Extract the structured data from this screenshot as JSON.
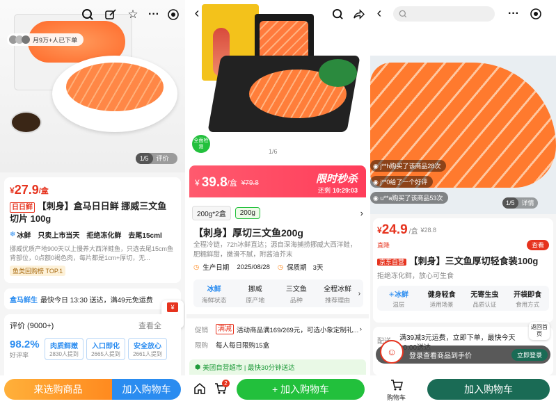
{
  "p1": {
    "join_text": "月9万+人已下单",
    "pager": "1/5",
    "review_tab": "评价",
    "price_symbol": "¥",
    "price_int": "27.9",
    "price_unit": "/盒",
    "brand_tag": "日日鲜",
    "title": "【刺身】盒马日日鲜 挪威三文鱼切片 100g",
    "features": [
      "冰鲜",
      "只卖上市当天",
      "拒绝冻化鲜",
      "去尾15cml"
    ],
    "desc": "挪威优质产地900天以上慢养大西洋鲑鱼，只选去尾15cm鱼背部位，0点额0褐色肉，每片都是1cm+厚切，无...",
    "rank": "鱼类回购榜 TOP.1",
    "delivery_brand": "盒马鲜生",
    "delivery_text": "最快今日 13:30 送达，满49元免运费",
    "card_coupon": "卡券",
    "review_title": "评价 (9000+)",
    "review_more": "查看全",
    "rate": "98.2%",
    "rate_label": "好评率",
    "review_tags": [
      {
        "title": "肉质鲜嫩",
        "sub": "2830人提到"
      },
      {
        "title": "入口即化",
        "sub": "2665人提到"
      },
      {
        "title": "安全放心",
        "sub": "2661人提到"
      }
    ],
    "btn_left": "来选购商品",
    "btn_right": "加入购物车"
  },
  "p2": {
    "pager": "1/6",
    "badge": "全面检测",
    "price_symbol": "¥",
    "price": "39.8",
    "price_unit": "/盒",
    "price_old": "¥79.8",
    "flash_title": "限时秒杀",
    "countdown_prefix": "还剩",
    "countdown": "10:29:03",
    "spec_options": [
      "200g*2盒",
      "200g"
    ],
    "title": "【刺身】厚切三文鱼200g",
    "desc": "全程冷链，72h冰鲜直达；源自深海捕捞挪威大西洋鲑，肥糯鲜甜，嫩滑不腻，附酱油芥末",
    "prod_label": "生产日期",
    "prod_date": "2025/08/28",
    "shelf_label": "保质期",
    "shelf_value": "3天",
    "attrs": [
      {
        "value": "冰鲜",
        "key": "海鲜状态"
      },
      {
        "value": "挪威",
        "key": "原产地"
      },
      {
        "value": "三文鱼",
        "key": "品种"
      },
      {
        "value": "全程冰鲜",
        "key": "推荐理由"
      }
    ],
    "promo_label": "促销",
    "promo_tag": "满减",
    "promo_text": "活动商品满169/269元，可选小象定制礼...",
    "limit_label": "限购",
    "limit_text": "每人每日限购15盒",
    "store_text": "美团自营超市 | 最快30分钟送达",
    "cart_count": "2",
    "btn_cart": "+ 加入购物车"
  },
  "p3": {
    "barrage": [
      "j**h购买了该商品28次",
      "j**0给了一个好评",
      "u**a购买了该商品53次"
    ],
    "pager": "1/5",
    "detail_tab": "详情",
    "price_symbol": "¥",
    "price": "24.9",
    "price_unit": "/盒",
    "price_old": "¥28.8",
    "direct_tag": "直降",
    "view_btn": "查看",
    "jd_tag": "京东自营",
    "title": "【刺身】三文鱼厚切轻食装100g",
    "desc": "拒绝冻化鲜，放心可生食",
    "attrs": [
      {
        "value": "冰鲜",
        "key": "温层"
      },
      {
        "value": "健身轻食",
        "key": "适用场景"
      },
      {
        "value": "无寄生虫",
        "key": "品质认证"
      },
      {
        "value": "开袋即食",
        "key": "食用方式"
      }
    ],
    "delivery_label": "配送",
    "delivery_text": "满39减3元运费，立即下单，最快今天10:00送达",
    "back_home": "返回首页",
    "login_text": "登录查看商品到手价",
    "login_btn": "立即登录",
    "cart_label": "购物车",
    "btn_cart": "加入购物车"
  },
  "colors": {
    "red": "#e6331e",
    "green": "#22c03c",
    "blue": "#2a8cf0",
    "orange": "#ff8a1f",
    "teal": "#1a6b55"
  }
}
